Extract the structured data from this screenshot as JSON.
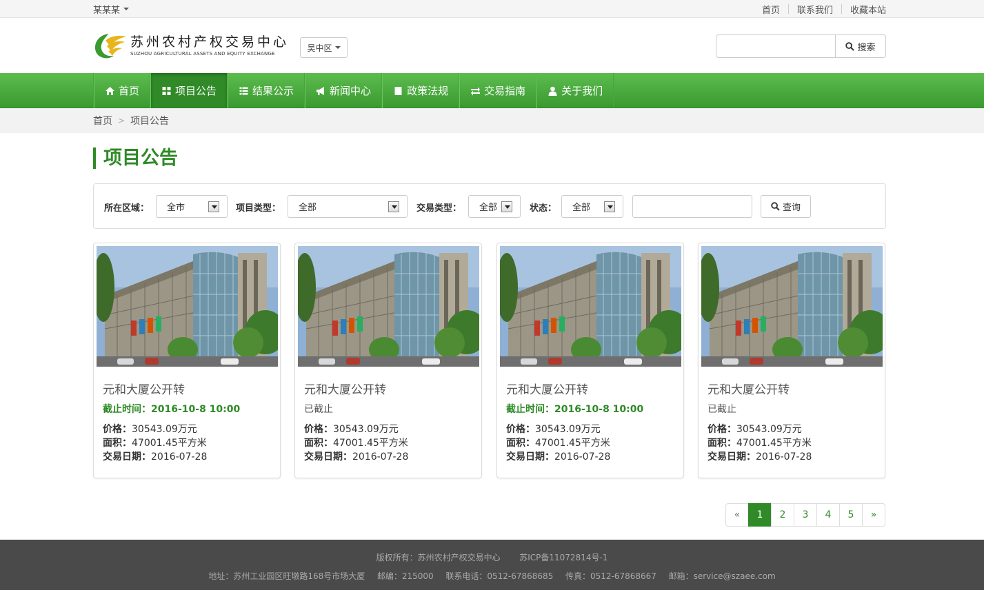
{
  "topbar": {
    "user": "某某某",
    "links": [
      "首页",
      "联系我们",
      "收藏本站"
    ]
  },
  "header": {
    "logo_cn": "苏州农村产权交易中心",
    "logo_en": "SUZHOU AGRICULTURAL ASSETS AND EQUITY EXCHANGE",
    "region": "吴中区",
    "search_button": "搜索",
    "search_value": ""
  },
  "nav": [
    {
      "label": "首页",
      "icon": "home-icon"
    },
    {
      "label": "项目公告",
      "icon": "grid-icon"
    },
    {
      "label": "结果公示",
      "icon": "list-icon"
    },
    {
      "label": "新闻中心",
      "icon": "bullhorn-icon"
    },
    {
      "label": "政策法规",
      "icon": "book-icon"
    },
    {
      "label": "交易指南",
      "icon": "swap-icon"
    },
    {
      "label": "关于我们",
      "icon": "user-icon"
    }
  ],
  "nav_active": "项目公告",
  "breadcrumb": {
    "home": "首页",
    "current": "项目公告",
    "divider": ">"
  },
  "page_title": "项目公告",
  "filter": {
    "region_label": "所在区域：",
    "region_value": "全市",
    "type_label": "项目类型：",
    "type_value": "全部",
    "trade_label": "交易类型：",
    "trade_value": "全部",
    "status_label": "状态：",
    "status_value": "全部",
    "keyword_value": "",
    "query_button": "查询"
  },
  "cards": [
    {
      "title": "元和大厦公开转",
      "deadline": "截止时间：2016-10-8 10:00",
      "closed": false,
      "price_label": "价格：",
      "price": "30543.09万元",
      "area_label": "面积：",
      "area": "47001.45平方米",
      "date_label": "交易日期：",
      "date": "2016-07-28"
    },
    {
      "title": "元和大厦公开转",
      "deadline": "已截止",
      "closed": true,
      "price_label": "价格：",
      "price": "30543.09万元",
      "area_label": "面积：",
      "area": "47001.45平方米",
      "date_label": "交易日期：",
      "date": "2016-07-28"
    },
    {
      "title": "元和大厦公开转",
      "deadline": "截止时间：2016-10-8 10:00",
      "closed": false,
      "price_label": "价格：",
      "price": "30543.09万元",
      "area_label": "面积：",
      "area": "47001.45平方米",
      "date_label": "交易日期：",
      "date": "2016-07-28"
    },
    {
      "title": "元和大厦公开转",
      "deadline": "已截止",
      "closed": true,
      "price_label": "价格：",
      "price": "30543.09万元",
      "area_label": "面积：",
      "area": "47001.45平方米",
      "date_label": "交易日期：",
      "date": "2016-07-28"
    }
  ],
  "pagination": {
    "prev": "«",
    "pages": [
      "1",
      "2",
      "3",
      "4",
      "5"
    ],
    "current": "1",
    "next": "»"
  },
  "footer": {
    "copyright": "版权所有：苏州农村产权交易中心",
    "icp": "苏ICP备11072814号-1",
    "address": "地址：苏州工业园区旺墩路168号市场大厦",
    "postcode": "邮编：215000",
    "phone": "联系电话：0512-67868685",
    "fax": "传真：0512-67868667",
    "email": "邮箱：service@szaee.com"
  },
  "colors": {
    "brand_green": "#2f8a27",
    "nav_green": "#4cab40",
    "footer_bg": "#4a4a4a"
  }
}
